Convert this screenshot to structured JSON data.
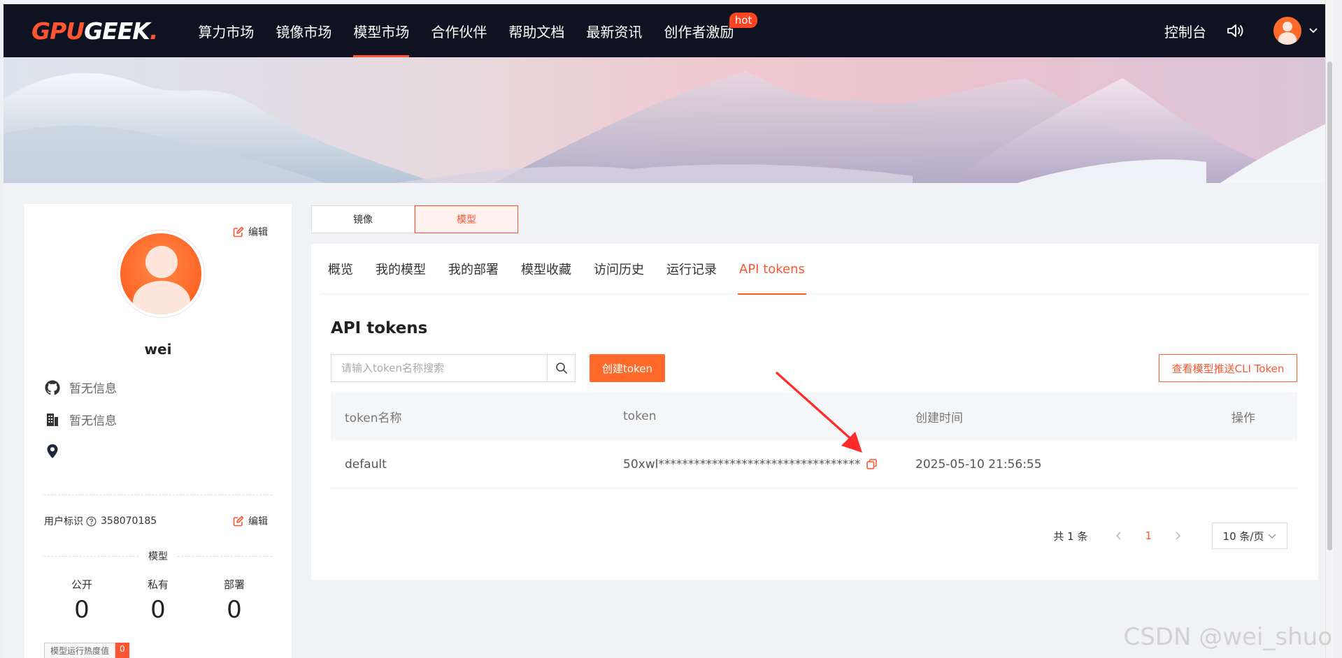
{
  "nav": {
    "logo_prefix": "GPU",
    "logo_suffix": "GEEK",
    "logo_dot": ".",
    "items": [
      {
        "label": "算力市场"
      },
      {
        "label": "镜像市场"
      },
      {
        "label": "模型市场",
        "active": true
      },
      {
        "label": "合作伙伴"
      },
      {
        "label": "帮助文档"
      },
      {
        "label": "最新资讯"
      },
      {
        "label": "创作者激励",
        "badge": "hot"
      }
    ],
    "console_label": "控制台",
    "icons": [
      "speaker-icon",
      "avatar",
      "chevron-down-icon"
    ]
  },
  "profile": {
    "edit_label": "编辑",
    "username": "wei",
    "github": "暂无信息",
    "company": "暂无信息",
    "location": "",
    "uid_label": "用户标识",
    "uid_value": "358070185",
    "uid_edit_label": "编辑",
    "section_label": "模型",
    "stats": [
      {
        "label": "公开",
        "value": "0"
      },
      {
        "label": "私有",
        "value": "0"
      },
      {
        "label": "部署",
        "value": "0"
      }
    ],
    "heat_label": "模型运行热度值",
    "heat_value": "0"
  },
  "switch": {
    "mirror": "镜像",
    "model": "模型"
  },
  "tabs": [
    {
      "label": "概览"
    },
    {
      "label": "我的模型"
    },
    {
      "label": "我的部署"
    },
    {
      "label": "模型收藏"
    },
    {
      "label": "访问历史"
    },
    {
      "label": "运行记录"
    },
    {
      "label": "API tokens",
      "active": true
    }
  ],
  "main": {
    "title": "API tokens",
    "search_placeholder": "请输入token名称搜索",
    "create_label": "创建token",
    "cli_label": "查看模型推送CLI Token",
    "columns": [
      "token名称",
      "token",
      "创建时间",
      "操作"
    ],
    "rows": [
      {
        "name": "default",
        "token": "50xwl**********************************",
        "created": "2025-05-10 21:56:55",
        "action": ""
      }
    ]
  },
  "pager": {
    "total": "共 1 条",
    "current": "1",
    "page_size": "10 条/页"
  },
  "watermark": "CSDN @wei_shuo",
  "colors": {
    "accent": "#ff5533",
    "nav_bg": "#0f1220",
    "annotation": "#ff2a2a"
  }
}
